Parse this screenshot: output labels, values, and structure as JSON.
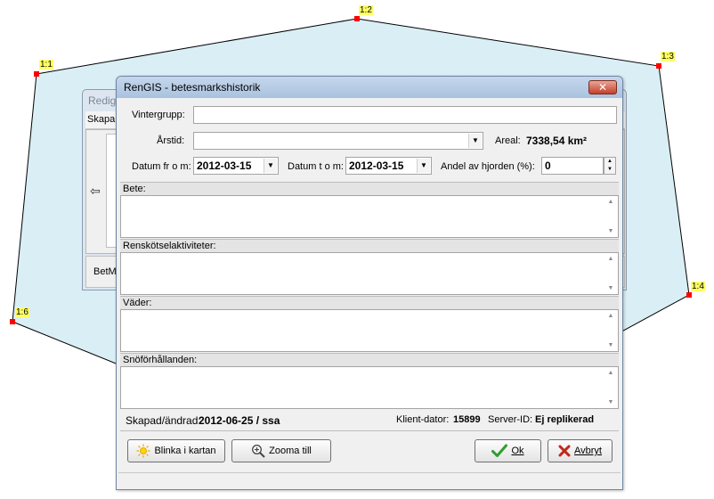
{
  "map": {
    "fill_color": "#daeef5",
    "edge_color": "#000000",
    "vertex_color": "#ff0000",
    "vertex_labels": [
      "1:1",
      "1:2",
      "1:3",
      "1:4",
      "1:6"
    ]
  },
  "background_window": {
    "title": "Redig",
    "menu_item": "Skapa",
    "bottom_label": "BetM"
  },
  "dialog": {
    "title": "RenGIS - betesmarkshistorik",
    "close_icon": "close-x-icon",
    "vintergrupp_label": "Vintergrupp:",
    "vintergrupp_value": "",
    "arstid_label": "Årstid:",
    "arstid_value": "",
    "areal_label": "Areal:",
    "areal_value": "7338,54 km²",
    "datum_from_label": "Datum fr o m:",
    "datum_from_value": "2012-03-15",
    "datum_to_label": "Datum t o m:",
    "datum_to_value": "2012-03-15",
    "andel_label": "Andel av hjorden (%):",
    "andel_value": "0",
    "sections": [
      {
        "label": "Bete:",
        "value": ""
      },
      {
        "label": "Renskötselaktiviteter:",
        "value": ""
      },
      {
        "label": "Väder:",
        "value": ""
      },
      {
        "label": "Snöförhållanden:",
        "value": ""
      }
    ],
    "skapad_label": "Skapad/ändrad:",
    "skapad_value": "2012-06-25 / ssa",
    "klient_label": "Klient-dator:",
    "klient_value": "15899",
    "server_label": "Server-ID:",
    "server_value": "Ej replikerad",
    "buttons": {
      "blinka": "Blinka i kartan",
      "zooma": "Zooma till",
      "ok": "Ok",
      "avbryt": "Avbryt"
    }
  }
}
